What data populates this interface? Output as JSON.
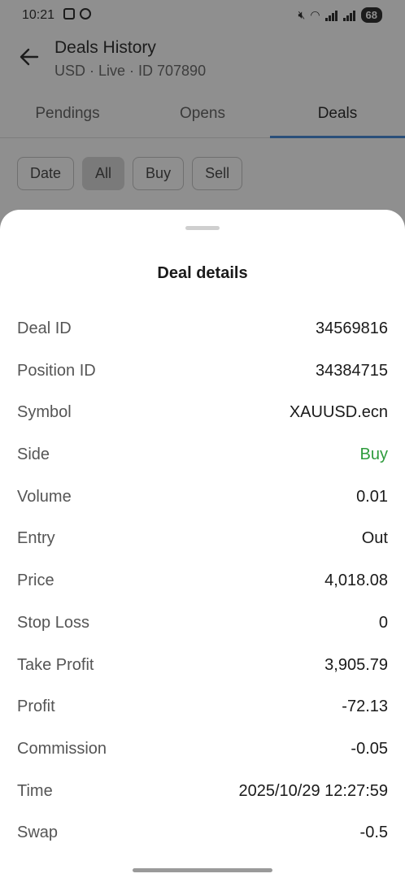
{
  "status_bar": {
    "time": "10:21",
    "battery": "68"
  },
  "header": {
    "title": "Deals History",
    "subtitle": "USD · Live · ID 707890"
  },
  "tabs": [
    {
      "label": "Pendings"
    },
    {
      "label": "Opens"
    },
    {
      "label": "Deals"
    }
  ],
  "filters": [
    {
      "label": "Date"
    },
    {
      "label": "All"
    },
    {
      "label": "Buy"
    },
    {
      "label": "Sell"
    }
  ],
  "sheet": {
    "title": "Deal details",
    "rows": [
      {
        "label": "Deal ID",
        "value": "34569816"
      },
      {
        "label": "Position ID",
        "value": "34384715"
      },
      {
        "label": "Symbol",
        "value": "XAUUSD.ecn"
      },
      {
        "label": "Side",
        "value": "Buy"
      },
      {
        "label": "Volume",
        "value": "0.01"
      },
      {
        "label": "Entry",
        "value": "Out"
      },
      {
        "label": "Price",
        "value": "4,018.08"
      },
      {
        "label": "Stop Loss",
        "value": "0"
      },
      {
        "label": "Take Profit",
        "value": "3,905.79"
      },
      {
        "label": "Profit",
        "value": "-72.13"
      },
      {
        "label": "Commission",
        "value": "-0.05"
      },
      {
        "label": "Time",
        "value": "2025/10/29 12:27:59"
      },
      {
        "label": "Swap",
        "value": "-0.5"
      }
    ]
  },
  "colors": {
    "buy": "#2e9b3c",
    "tab_indicator": "#2a4f7a",
    "scrim": "#8f8f8f"
  }
}
